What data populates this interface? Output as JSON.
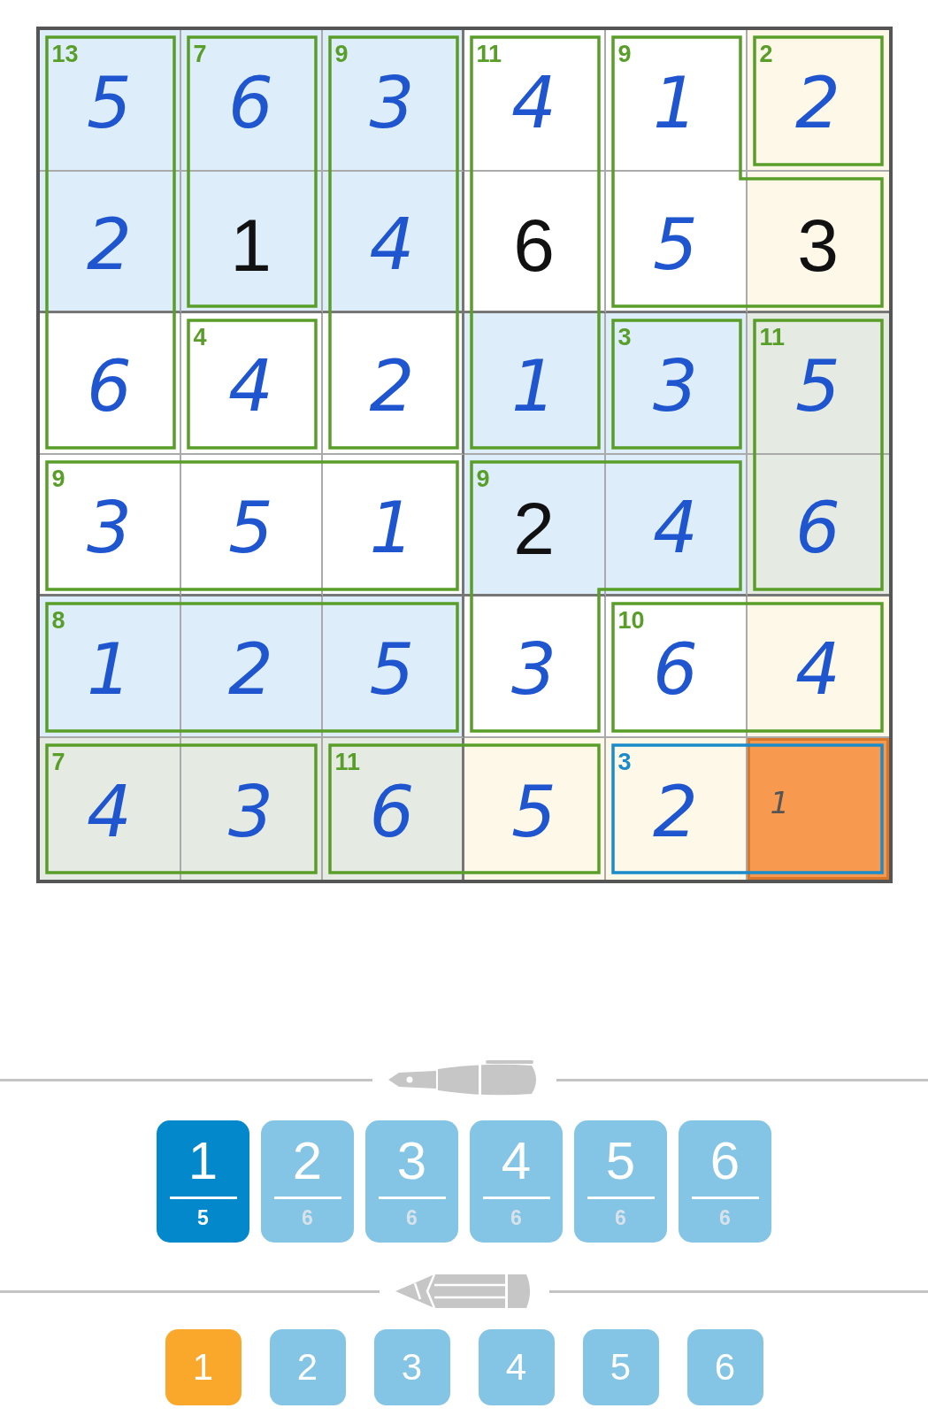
{
  "grid": {
    "rows": [
      {
        "cells": [
          {
            "value": "5",
            "given": false,
            "color": "#ddeefa",
            "selected": false
          },
          {
            "value": "6",
            "given": false,
            "color": "#ddeefa",
            "selected": false
          },
          {
            "value": "3",
            "given": false,
            "color": "#ddeefa",
            "selected": false
          },
          {
            "value": "4",
            "given": false,
            "color": "#ffffff",
            "selected": false
          },
          {
            "value": "1",
            "given": false,
            "color": "#ffffff",
            "selected": false
          },
          {
            "value": "2",
            "given": false,
            "color": "#fdf8e8",
            "selected": false
          }
        ]
      },
      {
        "cells": [
          {
            "value": "2",
            "given": false,
            "color": "#ddeefa",
            "selected": false
          },
          {
            "value": "1",
            "given": true,
            "color": "#ddeefa",
            "selected": false
          },
          {
            "value": "4",
            "given": false,
            "color": "#ddeefa",
            "selected": false
          },
          {
            "value": "6",
            "given": true,
            "color": "#ffffff",
            "selected": false
          },
          {
            "value": "5",
            "given": false,
            "color": "#ffffff",
            "selected": false
          },
          {
            "value": "3",
            "given": true,
            "color": "#fdf8e8",
            "selected": false
          }
        ]
      },
      {
        "cells": [
          {
            "value": "6",
            "given": false,
            "color": "#ffffff",
            "selected": false
          },
          {
            "value": "4",
            "given": false,
            "color": "#ffffff",
            "selected": false
          },
          {
            "value": "2",
            "given": false,
            "color": "#ffffff",
            "selected": false
          },
          {
            "value": "1",
            "given": false,
            "color": "#ddeefa",
            "selected": false
          },
          {
            "value": "3",
            "given": false,
            "color": "#ddeefa",
            "selected": false
          },
          {
            "value": "5",
            "given": false,
            "color": "#e5ebe2",
            "selected": false
          }
        ]
      },
      {
        "cells": [
          {
            "value": "3",
            "given": false,
            "color": "#ffffff",
            "selected": false
          },
          {
            "value": "5",
            "given": false,
            "color": "#ffffff",
            "selected": false
          },
          {
            "value": "1",
            "given": false,
            "color": "#ffffff",
            "selected": false
          },
          {
            "value": "2",
            "given": true,
            "color": "#ddeefa",
            "selected": false
          },
          {
            "value": "4",
            "given": false,
            "color": "#ddeefa",
            "selected": false
          },
          {
            "value": "6",
            "given": false,
            "color": "#e5ebe2",
            "selected": false
          }
        ]
      },
      {
        "cells": [
          {
            "value": "1",
            "given": false,
            "color": "#ddeefa",
            "selected": false
          },
          {
            "value": "2",
            "given": false,
            "color": "#ddeefa",
            "selected": false
          },
          {
            "value": "5",
            "given": false,
            "color": "#ddeefa",
            "selected": false
          },
          {
            "value": "3",
            "given": false,
            "color": "#ffffff",
            "selected": false
          },
          {
            "value": "6",
            "given": false,
            "color": "#ffffff",
            "selected": false
          },
          {
            "value": "4",
            "given": false,
            "color": "#fdf8e8",
            "selected": false
          }
        ]
      },
      {
        "cells": [
          {
            "value": "4",
            "given": false,
            "color": "#e5ebe2",
            "selected": false
          },
          {
            "value": "3",
            "given": false,
            "color": "#e5ebe2",
            "selected": false
          },
          {
            "value": "6",
            "given": false,
            "color": "#e5ebe2",
            "selected": false
          },
          {
            "value": "5",
            "given": false,
            "color": "#fdf8e8",
            "selected": false
          },
          {
            "value": "2",
            "given": false,
            "color": "#fdf8e8",
            "selected": false
          },
          {
            "pencil": "1",
            "color": "#f79a4f",
            "selected": true
          }
        ]
      }
    ],
    "cages": [
      {
        "sum": "13",
        "selected": false
      },
      {
        "sum": "7",
        "selected": false
      },
      {
        "sum": "9",
        "selected": false
      },
      {
        "sum": "11",
        "selected": false
      },
      {
        "sum": "9",
        "selected": false
      },
      {
        "sum": "2",
        "selected": false
      },
      {
        "sum": "4",
        "selected": false
      },
      {
        "sum": "3",
        "selected": false
      },
      {
        "sum": "11",
        "selected": false
      },
      {
        "sum": "9",
        "selected": false
      },
      {
        "sum": "9",
        "selected": false
      },
      {
        "sum": "8",
        "selected": false
      },
      {
        "sum": "10",
        "selected": false
      },
      {
        "sum": "7",
        "selected": false
      },
      {
        "sum": "11",
        "selected": false
      },
      {
        "sum": "3",
        "selected": true
      }
    ]
  },
  "pen_buttons": [
    {
      "digit": "1",
      "count": "5",
      "selected": true
    },
    {
      "digit": "2",
      "count": "6",
      "selected": false
    },
    {
      "digit": "3",
      "count": "6",
      "selected": false
    },
    {
      "digit": "4",
      "count": "6",
      "selected": false
    },
    {
      "digit": "5",
      "count": "6",
      "selected": false
    },
    {
      "digit": "6",
      "count": "6",
      "selected": false
    }
  ],
  "pencil_buttons": [
    {
      "digit": "1",
      "selected": true
    },
    {
      "digit": "2",
      "selected": false
    },
    {
      "digit": "3",
      "selected": false
    },
    {
      "digit": "4",
      "selected": false
    },
    {
      "digit": "5",
      "selected": false
    },
    {
      "digit": "6",
      "selected": false
    }
  ]
}
